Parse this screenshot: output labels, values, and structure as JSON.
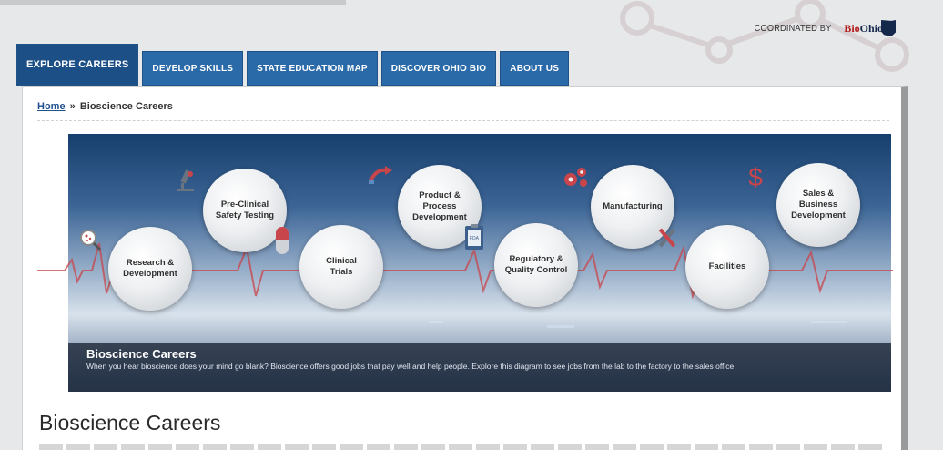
{
  "header": {
    "coordinated_label": "COORDINATED BY",
    "logo": {
      "part1": "Bio",
      "part2": "Ohio"
    }
  },
  "tabs": [
    {
      "label": "EXPLORE CAREERS",
      "active": true
    },
    {
      "label": "DEVELOP SKILLS",
      "active": false
    },
    {
      "label": "STATE EDUCATION MAP",
      "active": false
    },
    {
      "label": "DISCOVER OHIO BIO",
      "active": false
    },
    {
      "label": "ABOUT US",
      "active": false
    }
  ],
  "breadcrumb": {
    "home": "Home",
    "separator": "»",
    "current": "Bioscience Careers"
  },
  "diagram": {
    "careers": [
      {
        "label": "Research &\nDevelopment",
        "icon": "magnifier-icon"
      },
      {
        "label": "Pre-Clinical\nSafety Testing",
        "icon": "microscope-icon"
      },
      {
        "label": "Clinical\nTrials",
        "icon": "capsule-icon"
      },
      {
        "label": "Product &\nProcess\nDevelopment",
        "icon": "arrow-up-icon"
      },
      {
        "label": "Regulatory &\nQuality Control",
        "icon": "clipboard-icon"
      },
      {
        "label": "Manufacturing",
        "icon": "gears-icon"
      },
      {
        "label": "Facilities",
        "icon": "tools-icon"
      },
      {
        "label": "Sales &\nBusiness\nDevelopment",
        "icon": "dollar-icon"
      }
    ],
    "accent_color": "#c8464b",
    "clipboard_text": "FDA"
  },
  "caption": {
    "title": "Bioscience Careers",
    "text": "When you hear bioscience does your mind go blank? Bioscience offers good jobs that pay well and help people. Explore this diagram to see jobs from the lab to the factory to the sales office."
  },
  "page_title": "Bioscience Careers",
  "colors": {
    "tab_blue": "#2a6aa8",
    "tab_active": "#1c4f86",
    "link": "#1f4f8f"
  }
}
